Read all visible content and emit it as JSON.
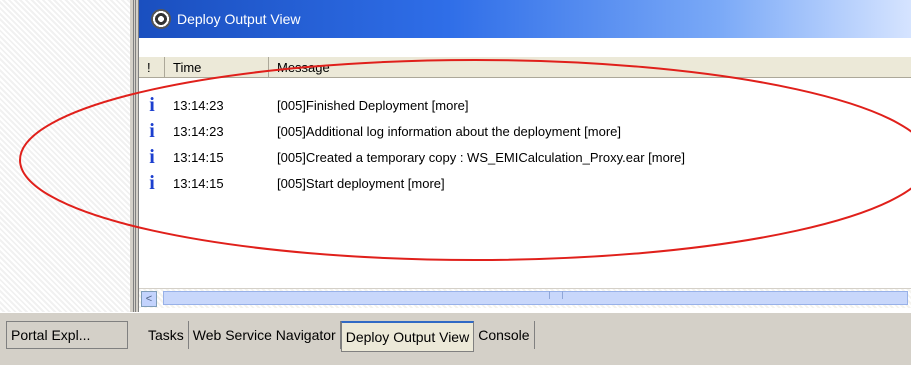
{
  "window": {
    "title": "Deploy Output View",
    "title_icon": "gear-icon"
  },
  "table": {
    "columns": {
      "severity": "!",
      "time": "Time",
      "message": "Message"
    },
    "rows": [
      {
        "icon": "i",
        "time": "13:14:23",
        "message": "[005]Finished Deployment  [more]"
      },
      {
        "icon": "i",
        "time": "13:14:23",
        "message": "[005]Additional log information about the deployment  [more]"
      },
      {
        "icon": "i",
        "time": "13:14:15",
        "message": "[005]Created a temporary copy : WS_EMICalculation_Proxy.ear [more]"
      },
      {
        "icon": "i",
        "time": "13:14:15",
        "message": "[005]Start deployment  [more]"
      }
    ]
  },
  "scrollbar": {
    "left_arrow": "<"
  },
  "left_tab": {
    "label": "Portal Expl..."
  },
  "tabs": [
    {
      "label": "Tasks",
      "active": false
    },
    {
      "label": "Web Service Navigator",
      "active": false
    },
    {
      "label": "Deploy Output View",
      "active": true
    },
    {
      "label": "Console",
      "active": false
    }
  ],
  "colors": {
    "title_bar": "#2f6ee8",
    "annotation": "#e0201b",
    "info_icon": "#1c3fcf"
  }
}
